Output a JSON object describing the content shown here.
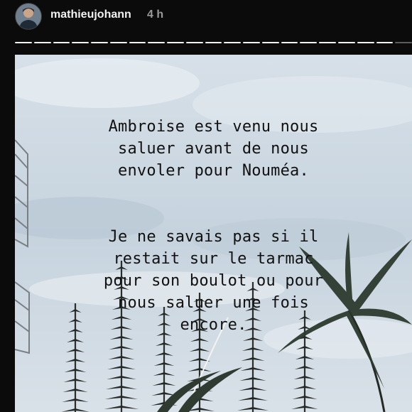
{
  "header": {
    "username": "mathieujohann",
    "time_ago": "4 h"
  },
  "progress": {
    "total_segments": 21,
    "current_segment": 20
  },
  "story": {
    "paragraph1": "Ambroise est venu nous\nsaluer avant de nous\nenvoler pour Nouméa.",
    "paragraph2": "Je ne savais pas si il\nrestait sur le tarmac\npour son boulot ou pour\nnous saluer une fois\nencore."
  }
}
